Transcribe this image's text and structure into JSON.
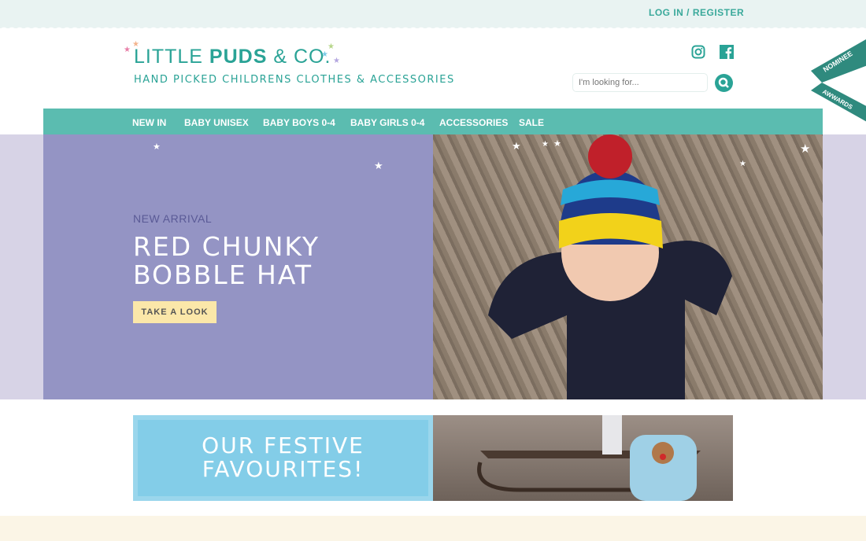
{
  "header": {
    "login_label": "LOG IN / REGISTER",
    "logo_light": "LITTLE ",
    "logo_bold": "PUDS",
    "logo_end": " & CO.",
    "tagline": "HAND PICKED CHILDRENS CLOTHES & ACCESSORIES",
    "search_placeholder": "I'm looking for...",
    "social": [
      "instagram-icon",
      "facebook-icon"
    ],
    "badge_top": "NOMINEE",
    "badge_bottom": "AWWARDS"
  },
  "nav": {
    "items": [
      {
        "label": "NEW IN"
      },
      {
        "label": "BABY UNISEX"
      },
      {
        "label": "BABY BOYS 0-4"
      },
      {
        "label": "BABY GIRLS 0-4"
      },
      {
        "label": "ACCESSORIES"
      },
      {
        "label": "SALE"
      }
    ]
  },
  "hero": {
    "eyebrow": "NEW ARRIVAL",
    "title": "RED CHUNKY BOBBLE HAT",
    "cta": "TAKE A LOOK"
  },
  "promo": {
    "title": "OUR FESTIVE FAVOURITES!"
  },
  "colors": {
    "brand": "#2aa396",
    "nav": "#5bbcb0",
    "hero": "#9494c4",
    "cta": "#fbe7a9",
    "promo": "#83cde8"
  }
}
